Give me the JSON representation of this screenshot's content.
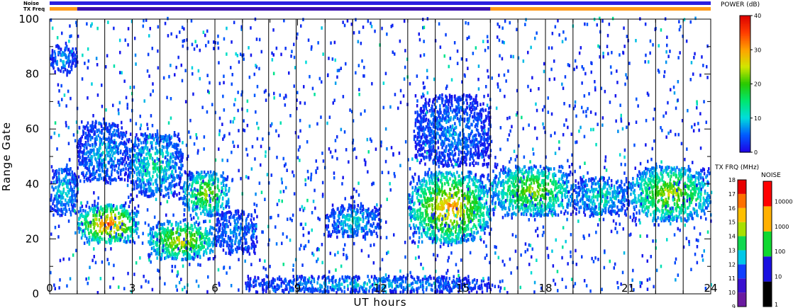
{
  "chart_data": {
    "type": "heatmap",
    "xlabel": "UT hours",
    "ylabel": "Range Gate",
    "xlim": [
      0,
      24
    ],
    "ylim": [
      0,
      100
    ],
    "x_ticks": [
      "0",
      "3",
      "6",
      "9",
      "12",
      "15",
      "18",
      "21",
      "24"
    ],
    "y_ticks": [
      "0",
      "20",
      "40",
      "60",
      "80",
      "100"
    ],
    "scan_boundaries_hours": [
      1.0,
      2.0,
      3.0,
      4.0,
      5.0,
      6.0,
      7.0,
      7.95,
      8.95,
      10.0,
      11.0,
      12.0,
      13.0,
      14.0,
      15.0,
      16.0,
      17.0,
      18.0,
      19.0,
      20.0,
      21.0,
      22.0,
      23.0
    ],
    "top_bars": {
      "noise_label": "Noise",
      "txfreq_label": "TX Freq",
      "noise_color": "#2a1ee0",
      "txfreq_segments": [
        {
          "start": 0,
          "end": 1.0,
          "color": "#ff9a1a"
        },
        {
          "start": 1.0,
          "end": 16.0,
          "color": "#3a0fb0"
        },
        {
          "start": 16.0,
          "end": 24,
          "color": "#ff9a1a"
        }
      ]
    },
    "echo_regions": [
      {
        "x": [
          0.0,
          1.0
        ],
        "y": [
          28,
          46
        ],
        "peak_db": 12
      },
      {
        "x": [
          0.0,
          1.0
        ],
        "y": [
          80,
          90
        ],
        "peak_db": 8
      },
      {
        "x": [
          1.0,
          3.2
        ],
        "y": [
          18,
          32
        ],
        "peak_db": 35
      },
      {
        "x": [
          1.0,
          2.8
        ],
        "y": [
          40,
          62
        ],
        "peak_db": 10
      },
      {
        "x": [
          2.8,
          4.8
        ],
        "y": [
          35,
          58
        ],
        "peak_db": 15
      },
      {
        "x": [
          3.5,
          6.0
        ],
        "y": [
          12,
          26
        ],
        "peak_db": 28
      },
      {
        "x": [
          4.8,
          6.5
        ],
        "y": [
          28,
          44
        ],
        "peak_db": 25
      },
      {
        "x": [
          6.0,
          7.5
        ],
        "y": [
          14,
          30
        ],
        "peak_db": 8
      },
      {
        "x": [
          10.0,
          12.0
        ],
        "y": [
          20,
          32
        ],
        "peak_db": 12
      },
      {
        "x": [
          13.0,
          16.0
        ],
        "y": [
          18,
          44
        ],
        "peak_db": 32
      },
      {
        "x": [
          13.2,
          16.0
        ],
        "y": [
          46,
          72
        ],
        "peak_db": 8
      },
      {
        "x": [
          16.0,
          19.0
        ],
        "y": [
          28,
          46
        ],
        "peak_db": 25
      },
      {
        "x": [
          19.0,
          21.0
        ],
        "y": [
          28,
          42
        ],
        "peak_db": 14
      },
      {
        "x": [
          21.0,
          24.0
        ],
        "y": [
          26,
          46
        ],
        "peak_db": 26
      },
      {
        "x": [
          7.0,
          16.0
        ],
        "y": [
          0,
          6
        ],
        "peak_db": 10
      }
    ],
    "power_colorbar": {
      "title": "POWER (dB)",
      "ticks": [
        "0",
        "10",
        "20",
        "30",
        "40"
      ],
      "range": [
        0,
        40
      ]
    },
    "txfreq_colorbar": {
      "title": "TX FRQ (MHz)",
      "ticks": [
        "9",
        "10",
        "11",
        "12",
        "13",
        "14",
        "15",
        "16",
        "17",
        "18"
      ]
    },
    "noise_colorbar": {
      "title": "NOISE",
      "ticks": [
        "1",
        "10",
        "100",
        "1000",
        "10000"
      ]
    }
  }
}
